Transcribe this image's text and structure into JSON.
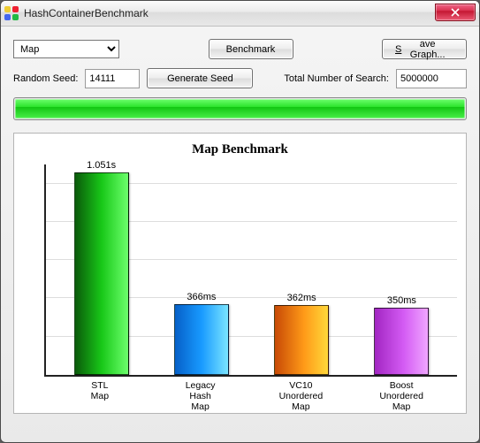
{
  "window": {
    "title": "HashContainerBenchmark"
  },
  "controls": {
    "combo_selected": "Map",
    "benchmark_btn": "Benchmark",
    "save_graph_btn": "Save Graph...",
    "random_seed_label": "Random Seed:",
    "random_seed_value": "14111",
    "generate_seed_btn": "Generate Seed",
    "total_search_label": "Total Number of Search:",
    "total_search_value": "5000000"
  },
  "progress": {
    "percent": 100
  },
  "chart_data": {
    "type": "bar",
    "title": "Map Benchmark",
    "xlabel": "",
    "ylabel": "",
    "ylim_ms": [
      0,
      1100
    ],
    "categories": [
      "STL Map",
      "Legacy Hash Map",
      "VC10 Unordered Map",
      "Boost Unordered Map"
    ],
    "values_ms": [
      1051,
      366,
      362,
      350
    ],
    "display_labels": [
      "1.051s",
      "366ms",
      "362ms",
      "350ms"
    ],
    "colors": [
      "green",
      "blue",
      "orange",
      "purple"
    ]
  }
}
